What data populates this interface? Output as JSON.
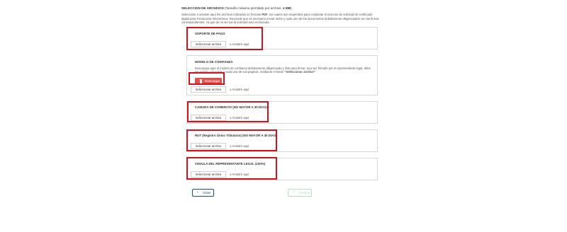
{
  "header": {
    "title": "SELECCION DE ARCHIVOS",
    "size_note": "(Tamaño máximo permitido por archivo: ",
    "size_value": "4 MB",
    "size_close": ")"
  },
  "intro": {
    "part1": "Seleccione o arrastre aquí los archivos indicados en formato ",
    "format": "PDF",
    "part2": ", los cuales son requeridos para completar el proceso de solicitud de certificado digital para Facturación Electrónica. Recuerde que es necesario enviar todos y cada uno de los documentos debidamente diligenciados con las firmas correspondientes. Ya que de no ser así la solicitud sera rechazada."
  },
  "upload_button_label": "Seleccionar archivo",
  "upload_hint": "o Arrastre aquí",
  "sections": {
    "soporte": {
      "title": "SOPORTE DE PAGO"
    },
    "modelo": {
      "title": "MODELO DE CONFIANZA",
      "desc_part1": "Descargue aquí el modelo de confianza debidamente diligenciado y listo para firmar, una vez firmado por el representante legal, debe ser subido con todas y cada una de sus paginas, mediante el botón ",
      "desc_bold": "\"Seleccionar archivo\"",
      "download_label": "Descargar"
    },
    "camara": {
      "title": "CAMARA DE COMERCIO (NO MAYOR A 30 DIAS)"
    },
    "rut": {
      "title": "RUT (Registro Único Tributario) (NO MAYOR A 30 DIAS)"
    },
    "cedula": {
      "title": "CEDULA DEL REPRESENTANTE LEGAL (150%)"
    }
  },
  "nav": {
    "back_label": "Volver",
    "next_label": "Finalizar"
  },
  "colors": {
    "highlight": "#d0121c",
    "download_bg": "#d9534f",
    "back_accent": "#1f4e79",
    "next_disabled": "#b8dec0"
  }
}
